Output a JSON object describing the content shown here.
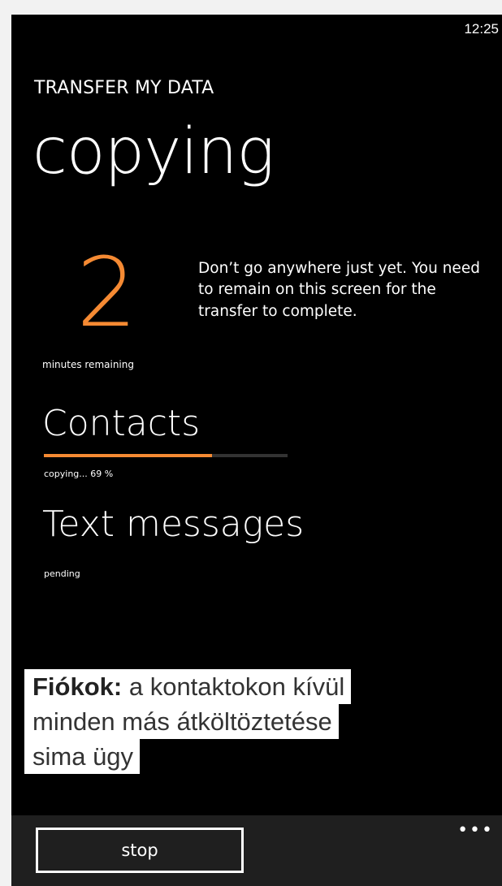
{
  "status_bar": {
    "time": "12:25"
  },
  "header": {
    "app_title": "TRANSFER MY DATA",
    "page_title": "copying"
  },
  "countdown": {
    "value": "2",
    "label": "minutes remaining",
    "message": "Don’t go anywhere just yet. You need to remain on this screen for the transfer to complete."
  },
  "items": [
    {
      "title": "Contacts",
      "status": "copying... 69 %",
      "progress_percent": 69
    },
    {
      "title": "Text messages",
      "status": "pending"
    }
  ],
  "caption": {
    "bold": "Fiókok:",
    "line1_rest": " a kontaktokon kívül",
    "line2": "minden más átköltöztetése",
    "line3": "sima ügy"
  },
  "appbar": {
    "stop_label": "stop",
    "more_icon": "more-ellipsis-icon",
    "more_glyph": "•••"
  },
  "colors": {
    "accent": "#f58a33",
    "background": "#000000",
    "appbar": "#1f1f1f"
  }
}
